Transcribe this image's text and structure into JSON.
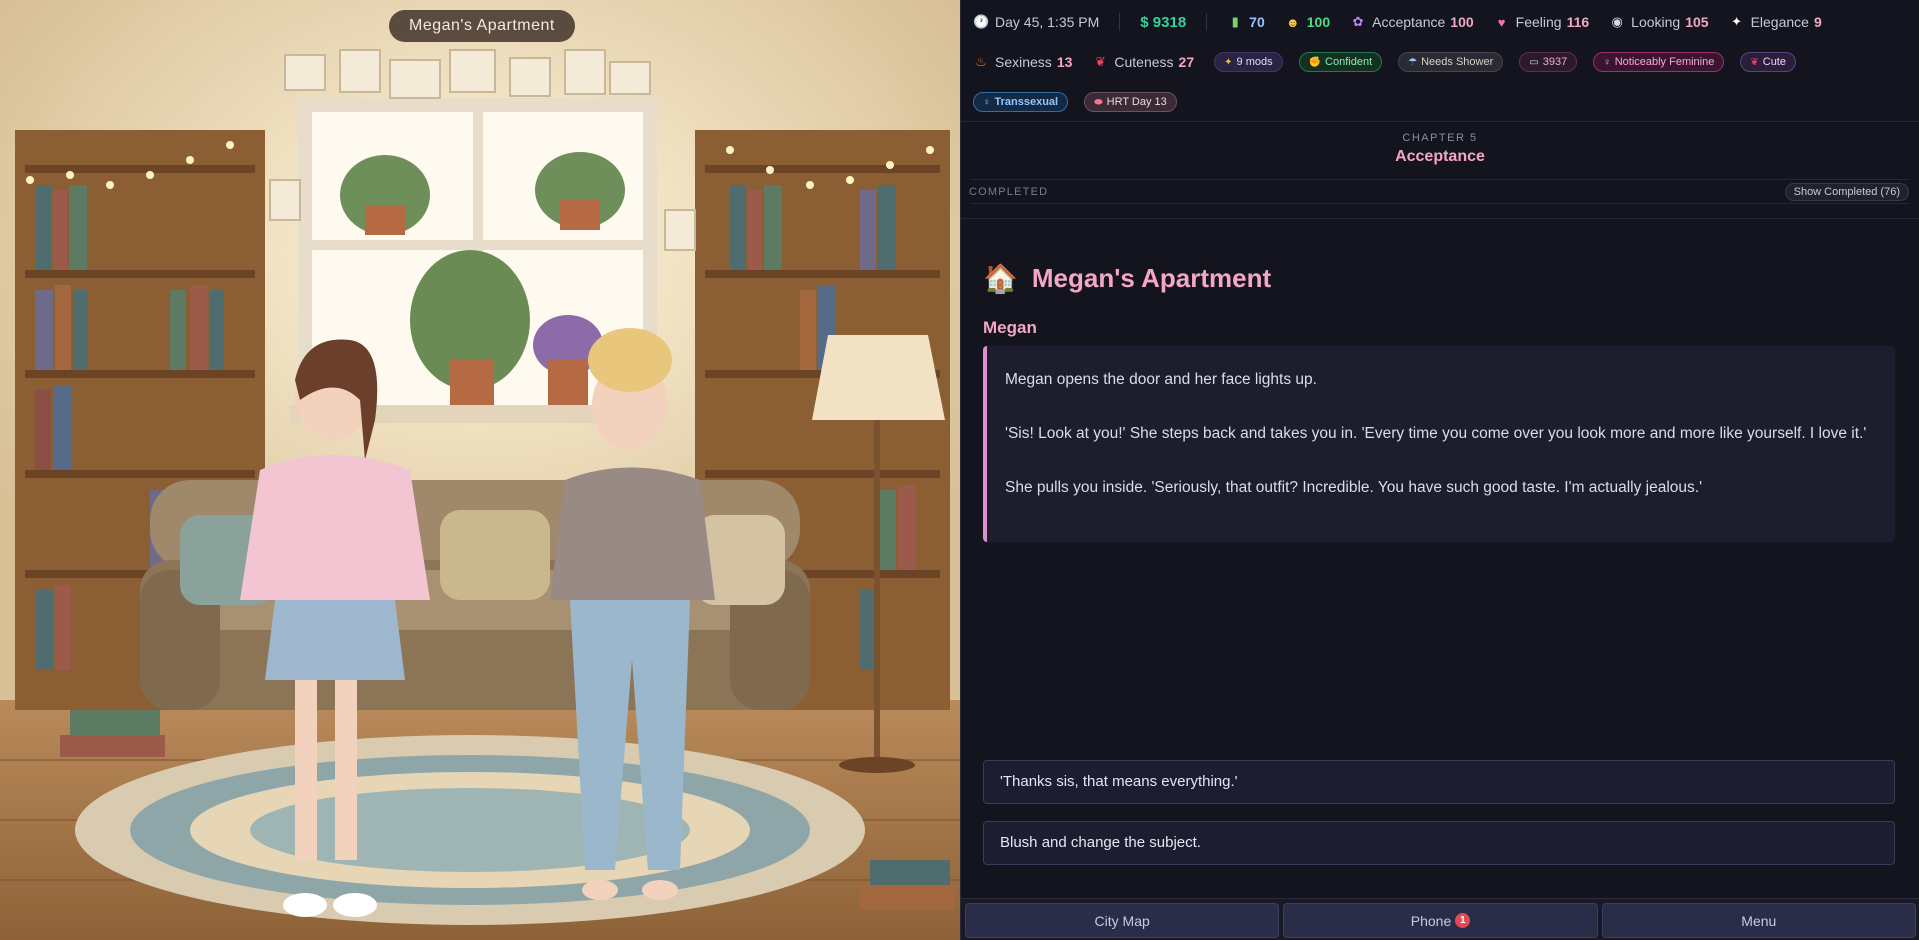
{
  "scene": {
    "location_label": "Megan's Apartment"
  },
  "status": {
    "day_time": "Day 45, 1:35 PM",
    "money": "$ 9318",
    "energy": "70",
    "mood": "100",
    "acceptance": {
      "label": "Acceptance",
      "value": "100"
    },
    "feeling": {
      "label": "Feeling",
      "value": "116"
    },
    "looking": {
      "label": "Looking",
      "value": "105"
    },
    "elegance": {
      "label": "Elegance",
      "value": "9"
    },
    "sexiness": {
      "label": "Sexiness",
      "value": "13"
    },
    "cuteness": {
      "label": "Cuteness",
      "value": "27"
    },
    "tags": {
      "mods": "9 mods",
      "confident": "Confident",
      "needs_shower": "Needs Shower",
      "code": "3937",
      "noticeably_feminine": "Noticeably Feminine",
      "cute": "Cute",
      "transsexual": "Transsexual",
      "hrt": "HRT Day 13"
    },
    "icons": {
      "clock": "clock-icon",
      "battery": "battery-icon",
      "mood": "smiley-icon",
      "acceptance": "butterfly-icon",
      "feeling": "heart-icon",
      "looking": "eye-icon",
      "elegance": "sparkle-icon",
      "sexiness": "flame-icon",
      "cuteness": "bow-icon"
    }
  },
  "chapter": {
    "label": "CHAPTER 5",
    "title": "Acceptance"
  },
  "completed": {
    "label": "COMPLETED",
    "button": "Show Completed (76)"
  },
  "location": {
    "icon": "🏠",
    "title": "Megan's Apartment"
  },
  "dialogue": {
    "speaker": "Megan",
    "paragraphs": [
      "Megan opens the door and her face lights up.",
      "'Sis! Look at you!' She steps back and takes you in. 'Every time you come over you look more and more like yourself. I love it.'",
      "She pulls you inside. 'Seriously, that outfit? Incredible. You have such good taste. I'm actually jealous.'"
    ]
  },
  "choices": [
    "'Thanks sis, that means everything.'",
    "Blush and change the subject."
  ],
  "nav": {
    "city_map": "City Map",
    "phone": "Phone",
    "phone_badge": "1",
    "menu": "Menu"
  },
  "colors": {
    "accent_pink": "#f3a6c8",
    "money_green": "#34d399",
    "panel_bg": "#14141f"
  }
}
